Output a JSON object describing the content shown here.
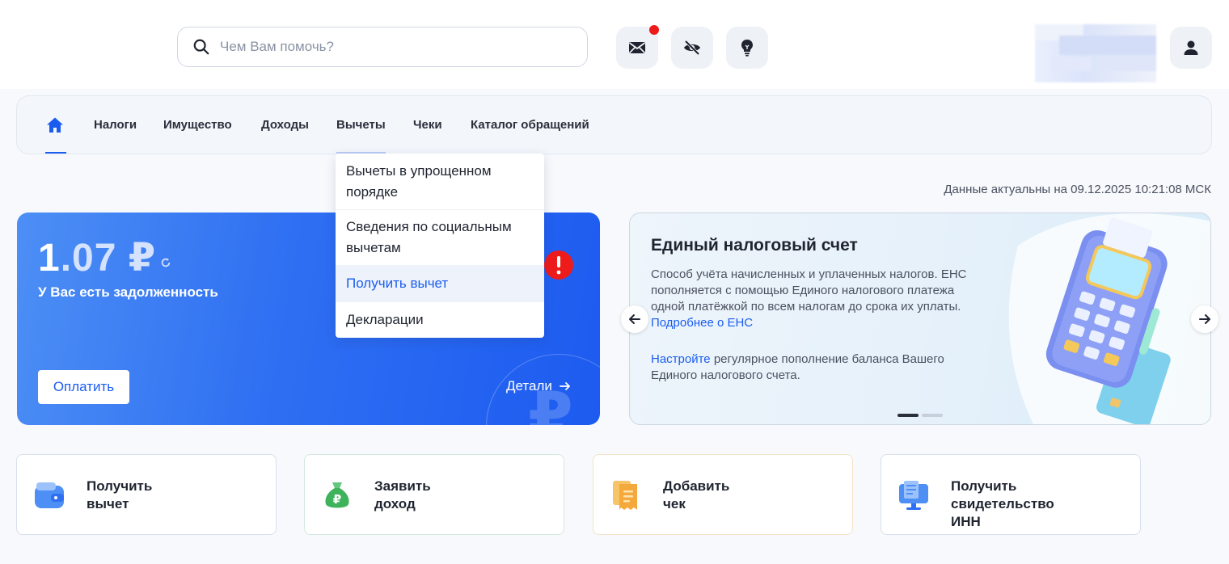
{
  "search": {
    "placeholder": "Чем Вам помочь?"
  },
  "header_icons": [
    "mail-icon",
    "eye-off-icon",
    "bulb-icon",
    "user-icon"
  ],
  "nav": {
    "items": [
      "Налоги",
      "Имущество",
      "Доходы",
      "Вычеты",
      "Чеки",
      "Каталог обращений"
    ]
  },
  "dropdown": {
    "items": [
      "Вычеты в упрощенном порядке",
      "Сведения по социальным вычетам",
      "Получить вычет",
      "Декларации"
    ]
  },
  "actual_date": "Данные актуальны на 09.12.2025 10:21:08 МСК",
  "debt": {
    "amount_first": "1",
    "amount_rest": ".07 ₽",
    "text": "У Вас есть задолженность",
    "pay_label": "Оплатить",
    "details_label": "Детали"
  },
  "ens": {
    "title": "Единый налоговый счет",
    "desc": "Способ учёта начисленных и уплаченных налогов. ЕНС пополняется с помощью Единого налогового платежа одной платёжкой по всем налогам до срока их уплаты.",
    "desc_link": "Подробнее о ЕНС",
    "setup_link": "Настройте",
    "setup_text": "регулярное пополнение баланса Вашего Единого налогового счета."
  },
  "tiles": [
    {
      "label": "Получить\nвычет"
    },
    {
      "label": "Заявить\nдоход"
    },
    {
      "label": "Добавить\nчек"
    },
    {
      "label": "Получить\nсвидетельство\nИНН"
    }
  ],
  "colors": {
    "accent": "#1a5cf0",
    "alert": "#ee1b1b"
  }
}
